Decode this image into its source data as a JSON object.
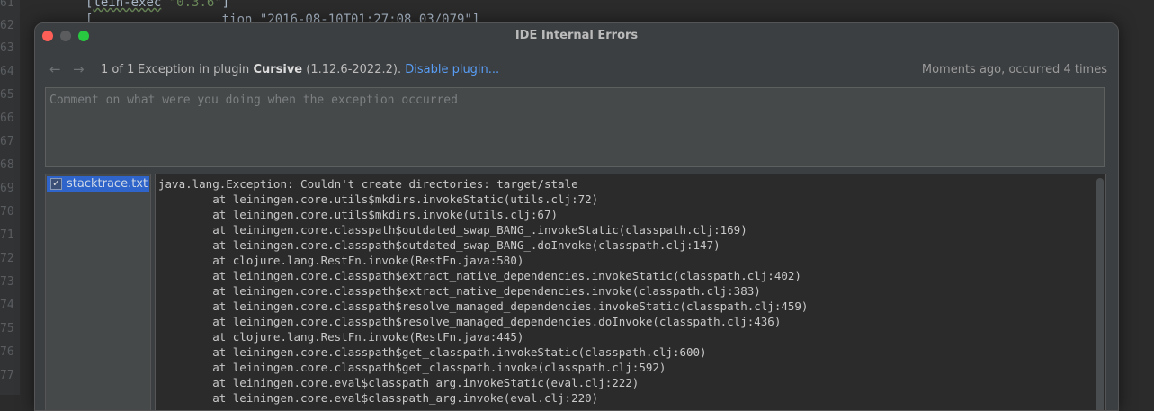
{
  "editor": {
    "line_numbers": [
      "61",
      "62",
      "63",
      "64",
      "65",
      "66",
      "67",
      "68",
      "69",
      "70",
      "71",
      "72",
      "73",
      "74",
      "75",
      "76",
      "77"
    ],
    "line1_name": "lein-exec",
    "line1_version": "\"0.3.6\"",
    "line1_bracket_open": "[",
    "line1_bracket_close": "]",
    "line2": "[                 tion \"2016-08-10T01:27:08.03/079\"]"
  },
  "dialog": {
    "title": "IDE Internal Errors",
    "nav_back": "←",
    "nav_forward": "→",
    "counter": "1 of 1",
    "message_prefix": "Exception in plugin ",
    "plugin_name": "Cursive",
    "plugin_version": " (1.12.6-2022.2). ",
    "disable_link": "Disable plugin...",
    "occurrence": "Moments ago, occurred 4 times",
    "comment_placeholder": "Comment on what were you doing when the exception occurred",
    "attachment": {
      "label": "stacktrace.txt",
      "checked": "✓"
    },
    "stacktrace": [
      "java.lang.Exception: Couldn't create directories: target/stale",
      "        at leiningen.core.utils$mkdirs.invokeStatic(utils.clj:72)",
      "        at leiningen.core.utils$mkdirs.invoke(utils.clj:67)",
      "        at leiningen.core.classpath$outdated_swap_BANG_.invokeStatic(classpath.clj:169)",
      "        at leiningen.core.classpath$outdated_swap_BANG_.doInvoke(classpath.clj:147)",
      "        at clojure.lang.RestFn.invoke(RestFn.java:580)",
      "        at leiningen.core.classpath$extract_native_dependencies.invokeStatic(classpath.clj:402)",
      "        at leiningen.core.classpath$extract_native_dependencies.invoke(classpath.clj:383)",
      "        at leiningen.core.classpath$resolve_managed_dependencies.invokeStatic(classpath.clj:459)",
      "        at leiningen.core.classpath$resolve_managed_dependencies.doInvoke(classpath.clj:436)",
      "        at clojure.lang.RestFn.invoke(RestFn.java:445)",
      "        at leiningen.core.classpath$get_classpath.invokeStatic(classpath.clj:600)",
      "        at leiningen.core.classpath$get_classpath.invoke(classpath.clj:592)",
      "        at leiningen.core.eval$classpath_arg.invokeStatic(eval.clj:222)",
      "        at leiningen.core.eval$classpath_arg.invoke(eval.clj:220)"
    ]
  },
  "colors": {
    "dialog_bg": "#3c3f41",
    "link": "#589df6",
    "selection": "#2f65ca",
    "close_light": "#ff5f57",
    "zoom_light": "#28c840"
  }
}
